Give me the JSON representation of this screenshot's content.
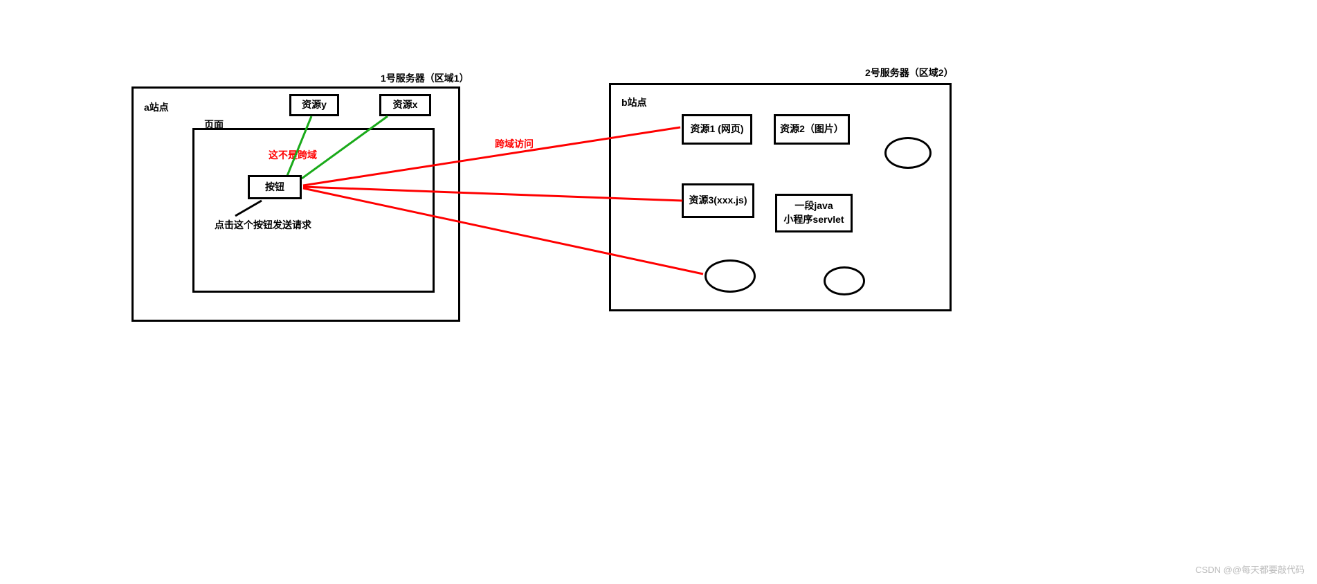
{
  "server1": {
    "title": "1号服务器（区域1）",
    "site_label": "a站点",
    "page_label": "页面",
    "resource_y": "资源y",
    "resource_x": "资源x",
    "button_label": "按钮",
    "click_hint": "点击这个按钮发送请求",
    "not_cross_origin": "这不是跨域"
  },
  "server2": {
    "title": "2号服务器（区域2）",
    "site_label": "b站点",
    "resource1": "资源1 (网页)",
    "resource2": "资源2（图片）",
    "resource3": "资源3(xxx.js)",
    "java_servlet": "一段java\n小程序servlet"
  },
  "cross_origin_label": "跨域访问",
  "watermark": "CSDN @@每天都要敲代码"
}
